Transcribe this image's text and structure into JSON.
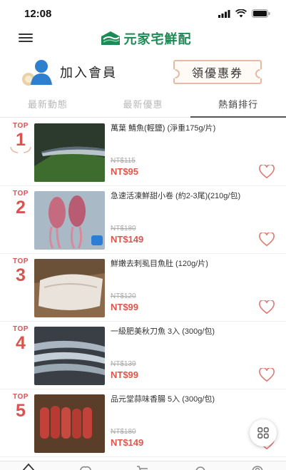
{
  "status_bar": {
    "time": "12:08"
  },
  "header": {
    "logo_text": "元家宅鮮配"
  },
  "member": {
    "join_label": "加入會員",
    "coupon_label": "領優惠券"
  },
  "tabs": [
    {
      "label": "最新動態",
      "active": false
    },
    {
      "label": "最新優惠",
      "active": false
    },
    {
      "label": "熱銷排行",
      "active": true
    }
  ],
  "products": [
    {
      "rank_top": "TOP",
      "rank": "1",
      "name": "萬葉 鯖魚(輕鹽) (淨重175g/片)",
      "old_price": "NT$115",
      "price": "NT$95"
    },
    {
      "rank_top": "TOP",
      "rank": "2",
      "name": "急速活凍鮮甜小卷 (約2-3尾)(210g/包)",
      "old_price": "NT$180",
      "price": "NT$149"
    },
    {
      "rank_top": "TOP",
      "rank": "3",
      "name": "鮮嫩去刺虱目魚肚 (120g/片)",
      "old_price": "NT$120",
      "price": "NT$99"
    },
    {
      "rank_top": "TOP",
      "rank": "4",
      "name": "一級肥美秋刀魚 3入 (300g/包)",
      "old_price": "NT$139",
      "price": "NT$99"
    },
    {
      "rank_top": "TOP",
      "rank": "5",
      "name": "品元堂蒜味香腸 5入 (300g/包)",
      "old_price": "NT$180",
      "price": "NT$149"
    }
  ],
  "colors": {
    "brand_green": "#1d8a55",
    "price_red": "#e0554a",
    "rank_red": "#d9534f"
  }
}
